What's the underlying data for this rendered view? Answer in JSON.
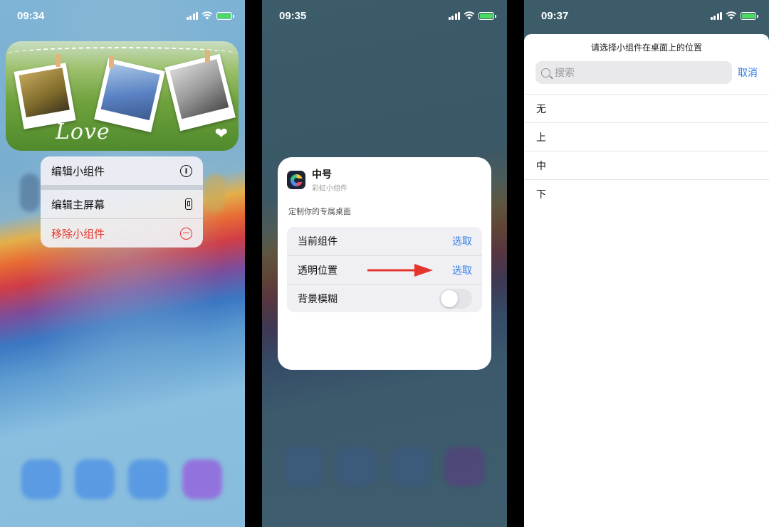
{
  "colors": {
    "accent": "#2f7be5",
    "danger": "#e5342e",
    "battery": "#4cd964"
  },
  "panel1": {
    "status_time": "09:34",
    "widget": {
      "caption": "Love",
      "badge_icon": "heart-icon"
    },
    "menu": {
      "items": [
        {
          "label": "编辑小组件",
          "icon": "info-icon"
        },
        {
          "label": "编辑主屏幕",
          "icon": "phone-icon"
        },
        {
          "label": "移除小组件",
          "icon": "minus-circle-icon"
        }
      ]
    }
  },
  "panel2": {
    "status_time": "09:35",
    "card": {
      "title": "中号",
      "subtitle": "彩虹小组件",
      "description": "定制你的专属桌面",
      "rows": [
        {
          "label": "当前组件",
          "action": "选取"
        },
        {
          "label": "透明位置",
          "action": "选取"
        },
        {
          "label": "背景模糊",
          "toggle_on": false
        }
      ]
    }
  },
  "panel3": {
    "status_time": "09:37",
    "sheet": {
      "title": "请选择小组件在桌面上的位置",
      "search_placeholder": "搜索",
      "cancel_label": "取消",
      "options": [
        "无",
        "上",
        "中",
        "下"
      ]
    }
  }
}
